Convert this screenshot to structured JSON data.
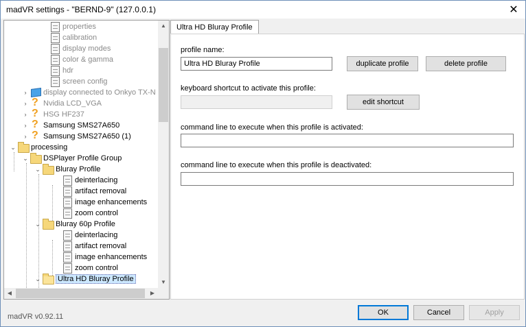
{
  "window": {
    "title": "madVR settings - \"BERND-9\" (127.0.0.1)",
    "close_symbol": "✕"
  },
  "tree": {
    "nodes": [
      {
        "label": "properties",
        "icon": "document-icon",
        "grey": true
      },
      {
        "label": "calibration",
        "icon": "document-icon",
        "grey": true
      },
      {
        "label": "display modes",
        "icon": "document-icon",
        "grey": true
      },
      {
        "label": "color & gamma",
        "icon": "document-icon",
        "grey": true
      },
      {
        "label": "hdr",
        "icon": "document-icon",
        "grey": true
      },
      {
        "label": "screen config",
        "icon": "document-icon",
        "grey": true
      },
      {
        "label": "display connected to Onkyo TX-N",
        "icon": "monitor-icon",
        "grey": true
      },
      {
        "label": "Nvidia LCD_VGA",
        "icon": "question-icon",
        "grey": true
      },
      {
        "label": "HSG HF237",
        "icon": "question-icon",
        "grey": true
      },
      {
        "label": "Samsung SMS27A650",
        "icon": "question-icon",
        "grey": false
      },
      {
        "label": "Samsung SMS27A650 (1)",
        "icon": "question-icon",
        "grey": false
      },
      {
        "label": "processing",
        "icon": "folder-icon",
        "grey": false
      },
      {
        "label": "DSPlayer Profile Group",
        "icon": "folder-icon",
        "grey": false
      },
      {
        "label": "Bluray Profile",
        "icon": "folder-icon",
        "grey": false
      },
      {
        "label": "deinterlacing",
        "icon": "document-icon",
        "grey": false
      },
      {
        "label": "artifact removal",
        "icon": "document-icon",
        "grey": false
      },
      {
        "label": "image enhancements",
        "icon": "document-icon",
        "grey": false
      },
      {
        "label": "zoom control",
        "icon": "document-icon",
        "grey": false
      },
      {
        "label": "Bluray 60p Profile",
        "icon": "folder-icon",
        "grey": false
      },
      {
        "label": "deinterlacing",
        "icon": "document-icon",
        "grey": false
      },
      {
        "label": "artifact removal",
        "icon": "document-icon",
        "grey": false
      },
      {
        "label": "image enhancements",
        "icon": "document-icon",
        "grey": false
      },
      {
        "label": "zoom control",
        "icon": "document-icon",
        "grey": false
      },
      {
        "label": "Ultra HD Bluray Profile",
        "icon": "folder-open-icon",
        "grey": false,
        "selected": true
      }
    ]
  },
  "tab": {
    "label": "Ultra HD Bluray Profile"
  },
  "form": {
    "profile_name_label": "profile name:",
    "profile_name_value": "Ultra HD Bluray Profile",
    "duplicate_label": "duplicate profile",
    "delete_label": "delete profile",
    "shortcut_label": "keyboard shortcut to activate this profile:",
    "shortcut_value": "",
    "edit_shortcut_label": "edit shortcut",
    "cmd_activated_label": "command line to execute when this profile is activated:",
    "cmd_activated_value": "",
    "cmd_deactivated_label": "command line to execute when this profile is deactivated:",
    "cmd_deactivated_value": ""
  },
  "footer": {
    "version": "madVR v0.92.11",
    "ok_label": "OK",
    "cancel_label": "Cancel",
    "apply_label": "Apply"
  }
}
